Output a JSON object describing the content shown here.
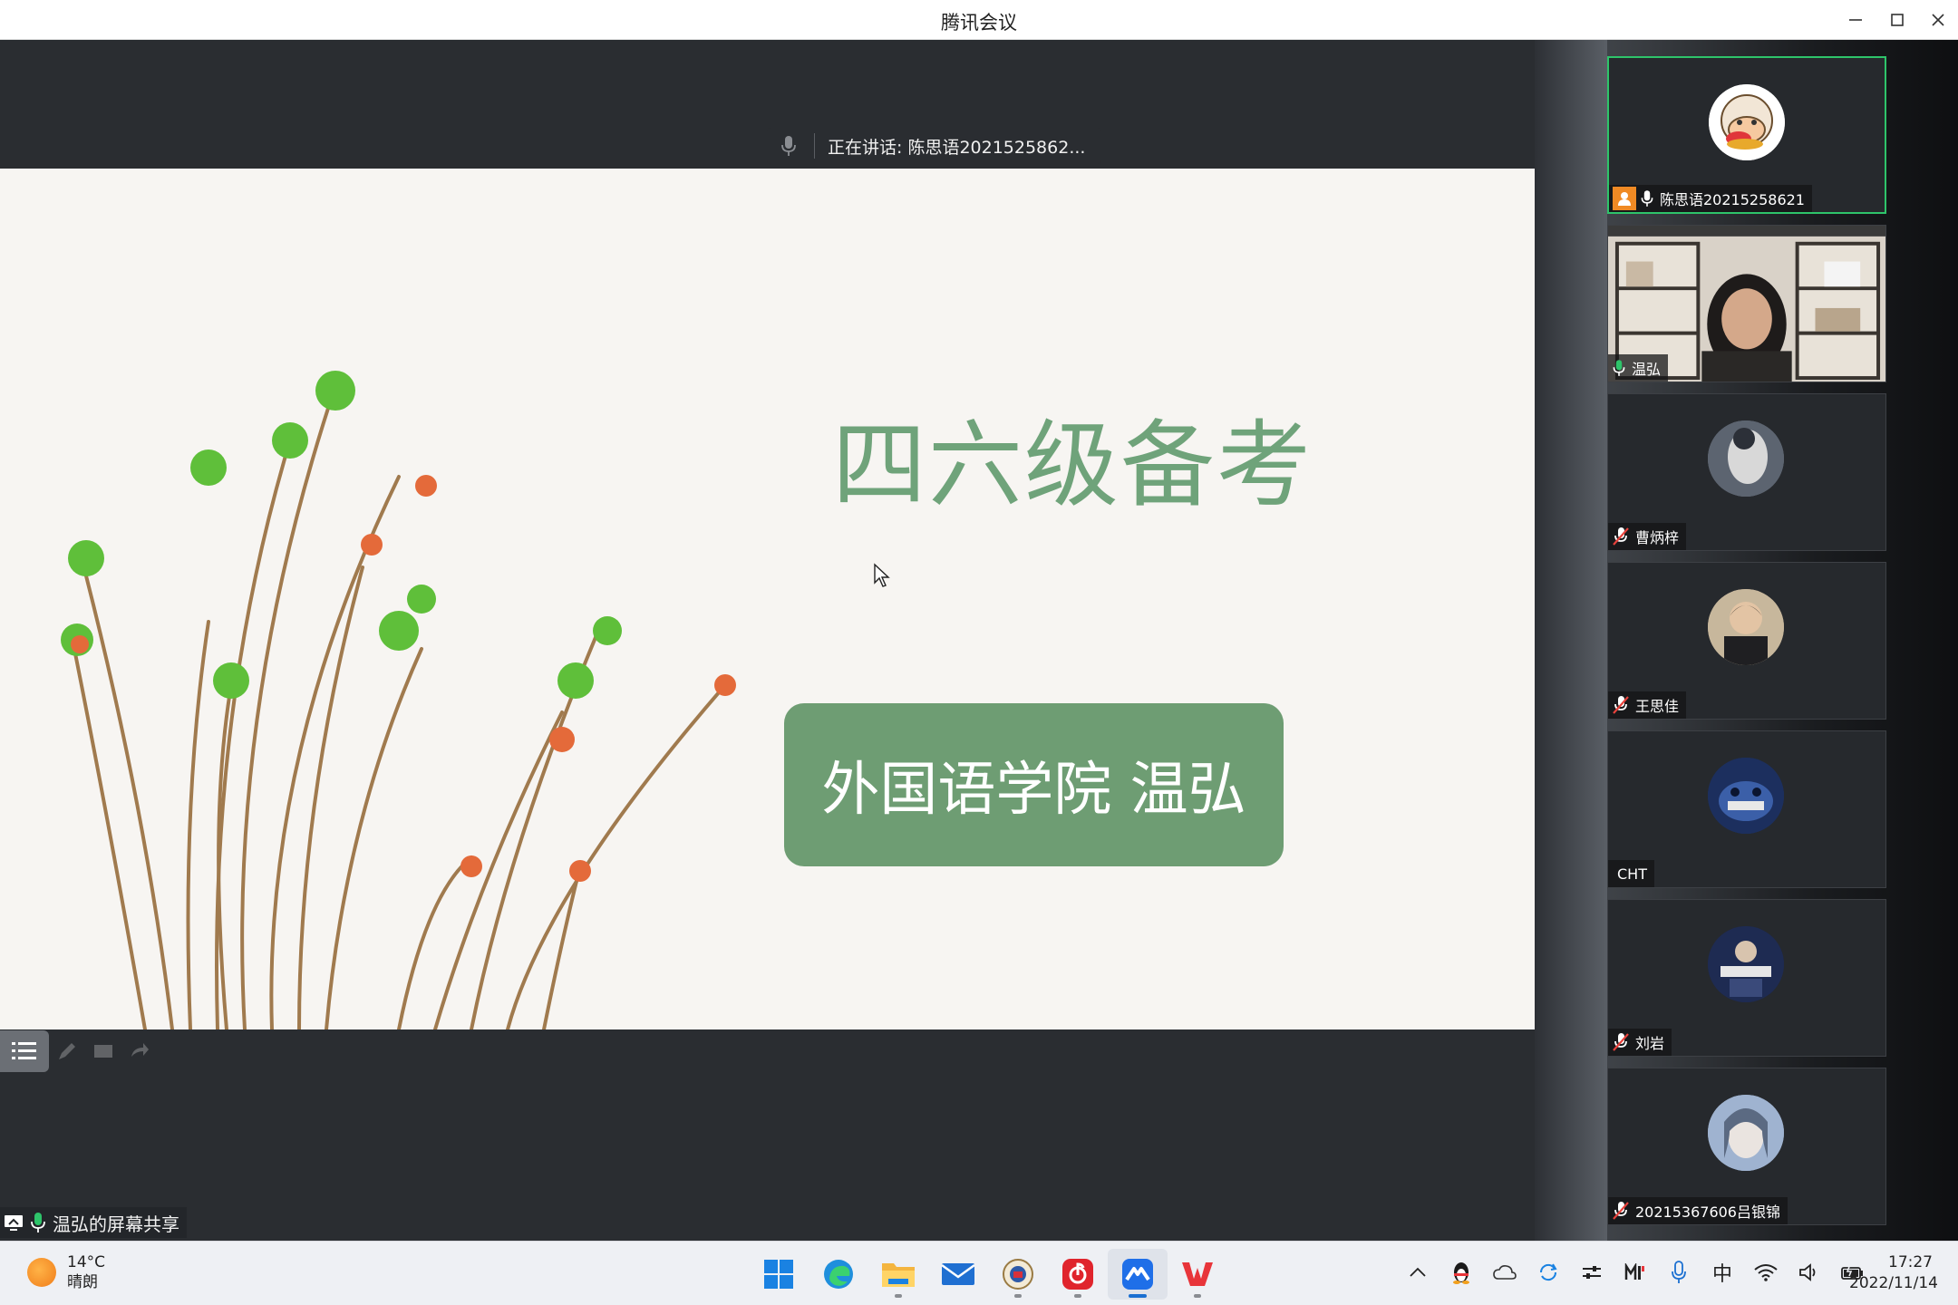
{
  "window": {
    "title": "腾讯会议"
  },
  "stage": {
    "speaking_text": "正在讲话: 陈思语2021525862...",
    "slide_title": "四六级备考",
    "slide_subtitle": "外国语学院 温弘",
    "share_label": "温弘的屏幕共享"
  },
  "participants": [
    {
      "name": "陈思语20215258621",
      "mic": "on",
      "host": true,
      "active": true,
      "avatar": "sheep-avatar-icon"
    },
    {
      "name": "温弘",
      "mic": "on",
      "host": false,
      "active": false,
      "avatar": "camera-video"
    },
    {
      "name": "曹炳梓",
      "mic": "muted",
      "host": false,
      "active": false,
      "avatar": "user-avatar"
    },
    {
      "name": "王思佳",
      "mic": "muted",
      "host": false,
      "active": false,
      "avatar": "user-avatar"
    },
    {
      "name": "CHT",
      "mic": "none",
      "host": false,
      "active": false,
      "avatar": "user-avatar"
    },
    {
      "name": "刘岩",
      "mic": "muted",
      "host": false,
      "active": false,
      "avatar": "user-avatar"
    },
    {
      "name": "20215367606吕银锦",
      "mic": "muted",
      "host": false,
      "active": false,
      "avatar": "user-avatar"
    }
  ],
  "taskbar": {
    "weather_temp": "14°C",
    "weather_desc": "晴朗",
    "ime": "中",
    "time": "17:27",
    "date": "2022/11/14"
  },
  "colors": {
    "slide_title": "#6fa37a",
    "slide_badge": "#6e9d73",
    "active_border": "#2ec46a",
    "host_badge": "#f08a24"
  }
}
